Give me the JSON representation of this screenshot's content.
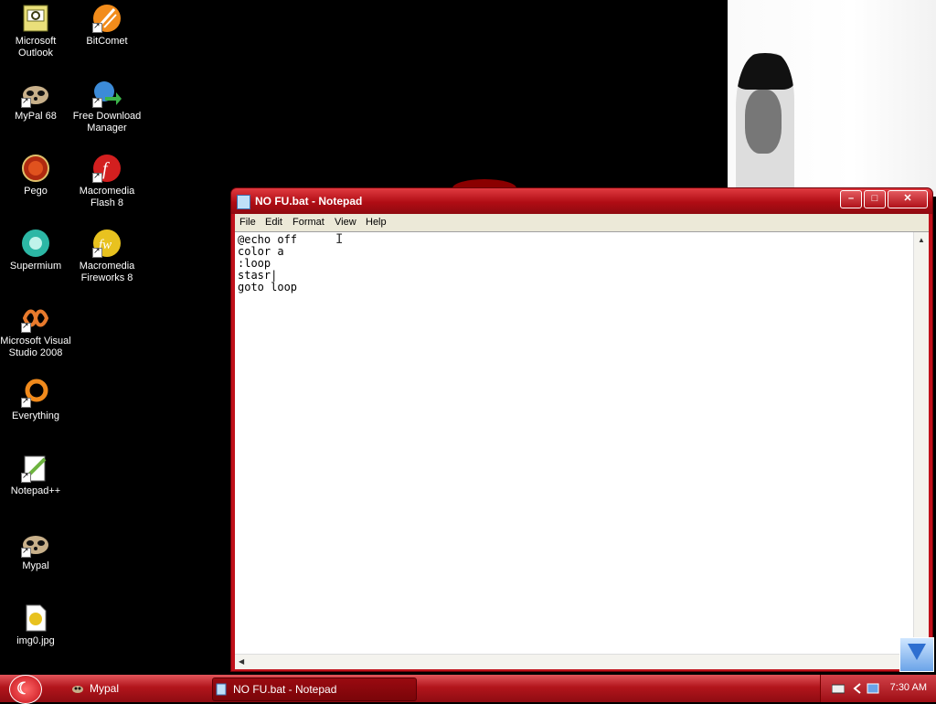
{
  "desktop": {
    "icons": [
      {
        "label": "Microsoft Outlook",
        "icon": "outlook-icon"
      },
      {
        "label": "BitComet",
        "icon": "bitcomet-icon"
      },
      {
        "label": "MyPal 68",
        "icon": "mypal-icon"
      },
      {
        "label": "Free Download Manager",
        "icon": "fdm-icon"
      },
      {
        "label": "Pego",
        "icon": "pego-icon"
      },
      {
        "label": "Macromedia Flash 8",
        "icon": "flash-icon"
      },
      {
        "label": "Supermium",
        "icon": "supermium-icon"
      },
      {
        "label": "Macromedia Fireworks 8",
        "icon": "fireworks-icon"
      },
      {
        "label": "Microsoft Visual Studio 2008",
        "icon": "visual-studio-icon"
      },
      {
        "label": "Everything",
        "icon": "everything-icon"
      },
      {
        "label": "Notepad++",
        "icon": "notepadpp-icon"
      },
      {
        "label": "Mypal",
        "icon": "mypal-icon"
      },
      {
        "label": "img0.jpg",
        "icon": "image-file-icon"
      }
    ]
  },
  "window": {
    "title": "NO FU.bat - Notepad",
    "menu": [
      "File",
      "Edit",
      "Format",
      "View",
      "Help"
    ],
    "content": "@echo off\ncolor a\n:loop\nstasr|\ngoto loop"
  },
  "taskbar": {
    "tasks": [
      "Mypal",
      "NO FU.bat - Notepad"
    ],
    "clock": "7:30 AM"
  },
  "colors": {
    "theme_red": "#b00c14",
    "desktop_bg": "#000000"
  }
}
